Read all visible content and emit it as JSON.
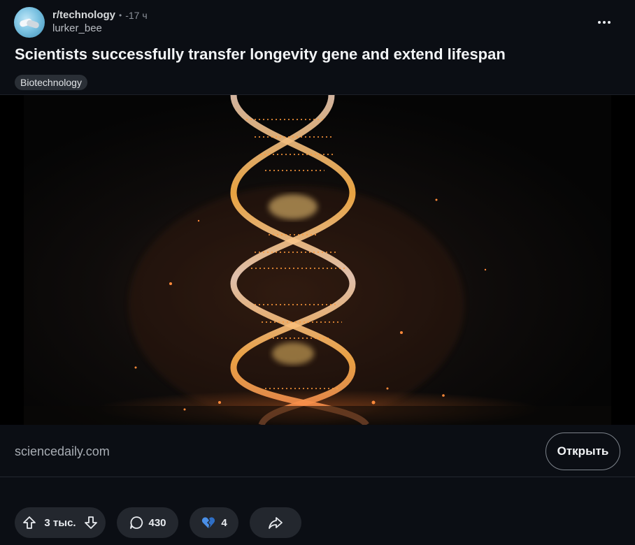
{
  "post": {
    "subreddit": "r/technology",
    "separator": "•",
    "time": "-17 ч",
    "author": "lurker_bee",
    "title": "Scientists successfully transfer longevity gene and extend lifespan",
    "flair": "Biotechnology"
  },
  "link": {
    "domain": "sciencedaily.com",
    "open_label": "Открыть"
  },
  "actions": {
    "votes": "3 тыс.",
    "comments": "430",
    "awards": "4"
  },
  "icons": {
    "avatar": "handshake-avatar",
    "more": "more-horizontal-icon",
    "upvote": "arrow-up-icon",
    "downvote": "arrow-down-icon",
    "comment": "comment-bubble-icon",
    "award": "broken-heart-icon",
    "share": "share-arrow-icon"
  },
  "colors": {
    "background": "#0b0e14",
    "pill": "#23272e",
    "award_blue": "#4a8fe7",
    "helix_glow": "#ff9a3c"
  }
}
